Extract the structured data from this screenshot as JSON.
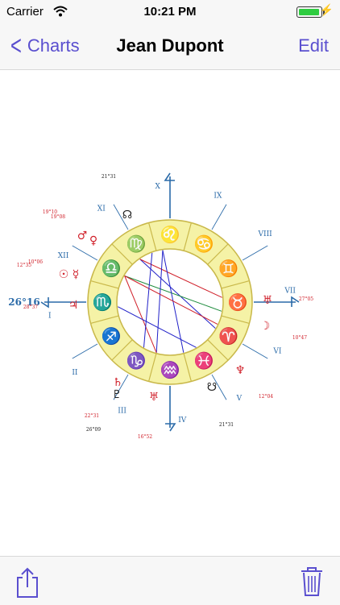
{
  "status_bar": {
    "carrier": "Carrier",
    "time": "10:21 PM",
    "battery_level": 0.95
  },
  "nav": {
    "back_label": "Charts",
    "title": "Jean Dupont",
    "edit_label": "Edit"
  },
  "chart": {
    "houses": [
      "X",
      "XI",
      "XII",
      "I",
      "II",
      "III",
      "IV",
      "V",
      "VI",
      "VII",
      "VIII",
      "IX"
    ],
    "zodiac": [
      "♌",
      "♋",
      "♊",
      "♉",
      "♈",
      "♓",
      "♒",
      "♑",
      "♐",
      "♏",
      "♎",
      "♍"
    ],
    "ascendant_label": "26°16",
    "degree_labels": [
      "21°31",
      "19°10",
      "19°08",
      "12°35",
      "10°06",
      "28°37",
      "22°31",
      "26°09",
      "16°52",
      "21°31",
      "12°04",
      "10°47",
      "27°05"
    ],
    "planets": [
      "☊",
      "♂",
      "♀",
      "☉",
      "☿",
      "♃",
      "♄",
      "♇",
      "♅",
      "☋",
      "♆",
      "☽",
      "♅"
    ],
    "colors": {
      "accent": "#5a4fcf",
      "ring_fill": "#f5f2a6",
      "ring_stroke": "#c9b84a",
      "axis": "#2a6aa8",
      "degree_red": "#d0202a",
      "aspect_blue": "#2020c8",
      "aspect_green": "#1a8a3a"
    }
  },
  "toolbar": {
    "share_icon": "share-icon",
    "trash_icon": "trash-icon"
  }
}
